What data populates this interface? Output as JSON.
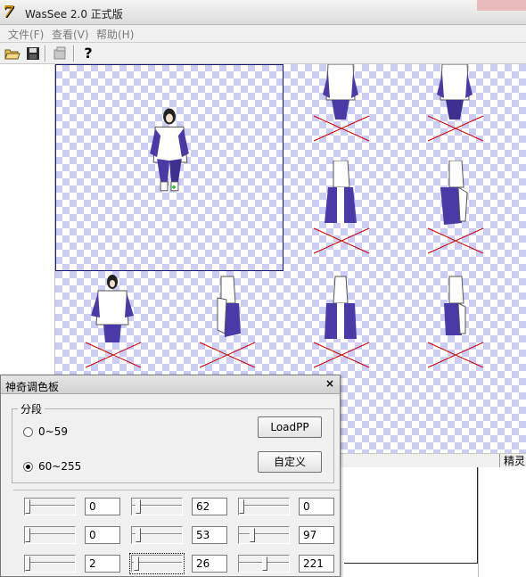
{
  "window": {
    "title": "WasSee 2.0 正式版"
  },
  "menu": {
    "items": [
      "文件(F)",
      "查看(V)",
      "帮助(H)"
    ]
  },
  "toolbar": {
    "icons": [
      "open-folder-icon",
      "save-disk-icon",
      "disabled-tool-icon",
      "help-question-icon"
    ],
    "help_glyph": "?"
  },
  "status": {
    "cell": "精灵"
  },
  "palette": {
    "title": "神奇调色板",
    "close": "×",
    "group_label": "分段",
    "range_low": "0~59",
    "range_high": "60~255",
    "selected_range": "60~255",
    "load_button": "LoadPP",
    "custom_button": "自定义",
    "rows": [
      {
        "values": [
          "0",
          "62",
          "0"
        ]
      },
      {
        "values": [
          "0",
          "53",
          "97"
        ]
      },
      {
        "values": [
          "2",
          "26",
          "221"
        ]
      }
    ]
  },
  "colors": {
    "checker": "#cccdf2",
    "robe": "#4a3aa8",
    "white": "#ffffff",
    "shadow": "#cc0000"
  }
}
